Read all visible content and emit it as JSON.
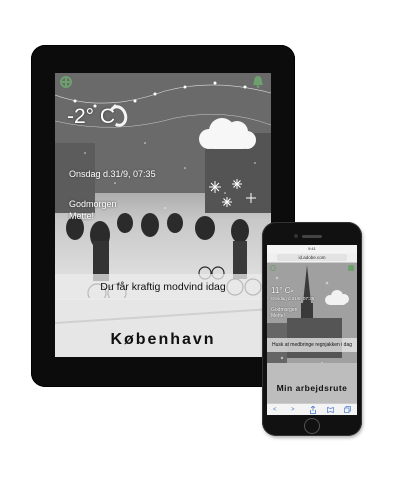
{
  "tablet": {
    "temperature": "-2° C",
    "date": "Onsdag d.31/9, 07:35",
    "greeting_line1": "Godmorgen",
    "greeting_line2": "Mette!",
    "banner": "Du får kraftig modvind idag",
    "city": "København",
    "page_dots": 3,
    "active_dot": 1
  },
  "phone": {
    "status_time": "9:41",
    "url": "id.adobe.com",
    "temperature": "11° C",
    "date": "Onsdag d.31/9, 07:35",
    "greeting_line1": "Godmorgen",
    "greeting_line2": "Mette!",
    "banner": "Husk at medbringe regnjakken i dag",
    "route": "Min arbejdsrute",
    "nav_back": "<",
    "nav_forward": ">"
  },
  "icons": {
    "tablet_left": "settings-icon",
    "tablet_right": "bell-icon",
    "weather": "cloud-icon",
    "moon": "moon-icon"
  },
  "colors": {
    "accent_green": "#6ea06e",
    "nav_blue": "#4a7bd0"
  }
}
